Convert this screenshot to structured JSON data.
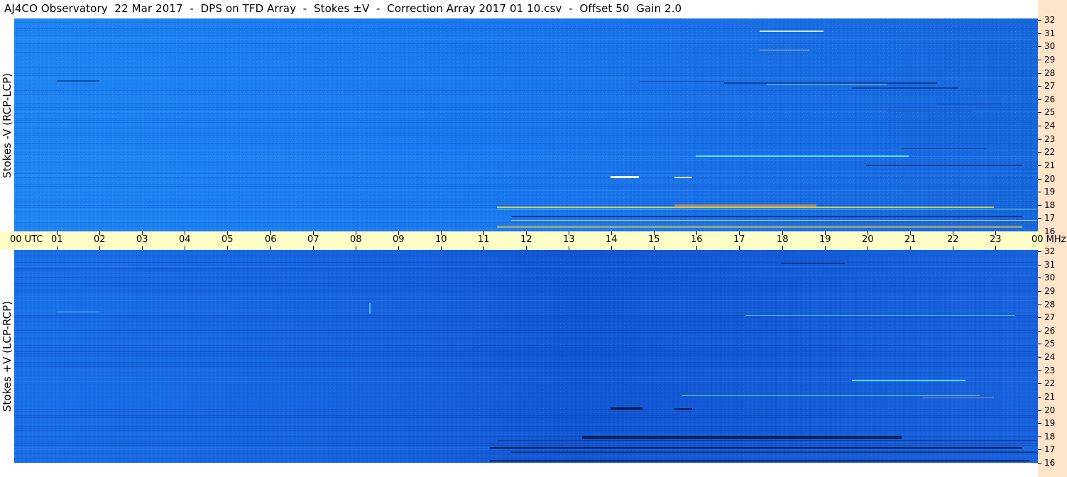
{
  "header": {
    "title": "AJ4CO Observatory  22 Mar 2017  -  DPS on TFD Array  -  Stokes ±V  -  Correction Array 2017 01 10.csv  -  Offset 50  Gain 2.0"
  },
  "panels": {
    "top_label": "Stokes -V (RCP-LCP)",
    "bottom_label": "Stokes +V (LCP-RCP)"
  },
  "time_axis": {
    "start_label": "00 UTC",
    "hour_labels": [
      "01",
      "02",
      "03",
      "04",
      "05",
      "06",
      "07",
      "08",
      "09",
      "10",
      "11",
      "12",
      "13",
      "14",
      "15",
      "16",
      "17",
      "18",
      "19",
      "20",
      "21",
      "22",
      "23"
    ],
    "end_label": "00 MHz"
  },
  "frequency_axis": {
    "labels": [
      "32",
      "31",
      "30",
      "29",
      "28",
      "27",
      "26",
      "25",
      "24",
      "23",
      "22",
      "21",
      "20",
      "19",
      "18",
      "17",
      "16"
    ]
  },
  "colors": {
    "background_blue": "#1a73ee",
    "scale_bg": "#ffe4cc",
    "time_axis_bg": "#ffffc8"
  }
}
